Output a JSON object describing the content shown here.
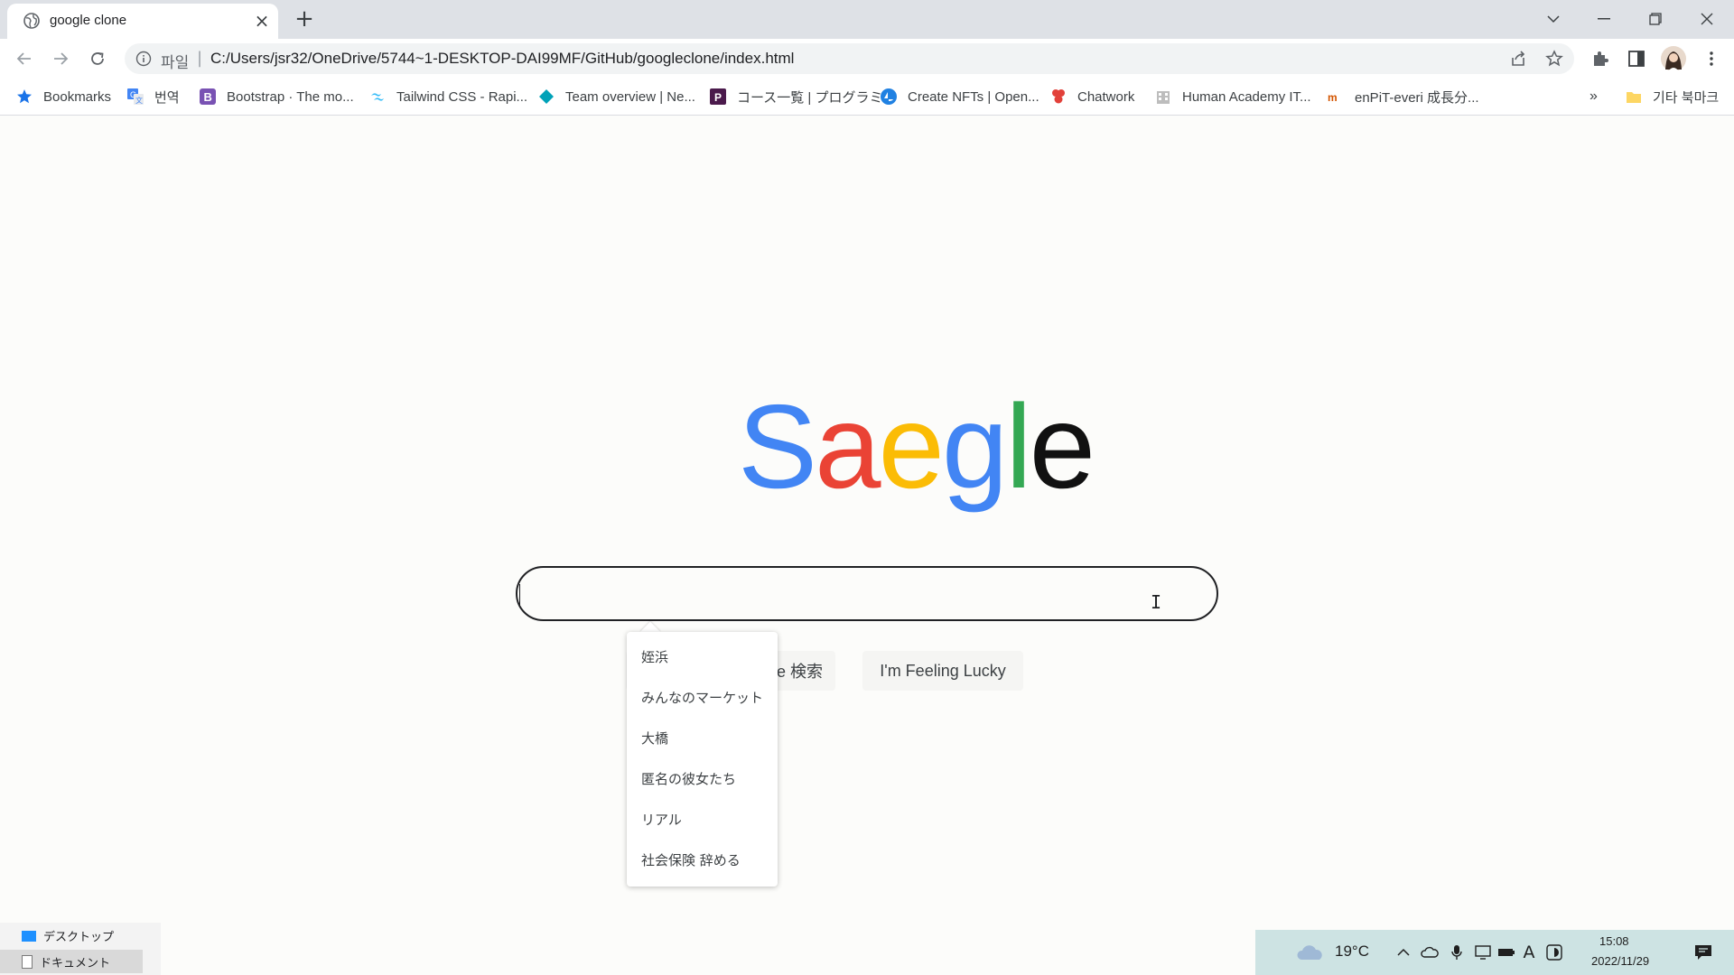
{
  "browser": {
    "tab_title": "google clone",
    "url_scheme_label": "파일",
    "url": "C:/Users/jsr32/OneDrive/5744~1-DESKTOP-DAI99MF/GitHub/googleclone/index.html"
  },
  "bookmarks": [
    {
      "label": "Bookmarks",
      "icon": "star-icon",
      "color": "#1a73e8"
    },
    {
      "label": "번역",
      "icon": "translate-icon",
      "color": "#4285f4"
    },
    {
      "label": "Bootstrap · The mo...",
      "icon": "bootstrap-icon",
      "color": "#7952b3"
    },
    {
      "label": "Tailwind CSS - Rapi...",
      "icon": "tailwind-icon",
      "color": "#38bdf8"
    },
    {
      "label": "Team overview | Ne...",
      "icon": "diamond-icon",
      "color": "#00a2b8"
    },
    {
      "label": "コース一覧 | プログラミ...",
      "icon": "progate-icon",
      "color": "#4b1a4c"
    },
    {
      "label": "Create NFTs | Open...",
      "icon": "opensea-icon",
      "color": "#2081e2"
    },
    {
      "label": "Chatwork",
      "icon": "chatwork-icon",
      "color": "#e2413a"
    },
    {
      "label": "Human Academy IT...",
      "icon": "building-icon",
      "color": "#777777"
    },
    {
      "label": "enPiT-everi 成長分...",
      "icon": "enpit-icon",
      "color": "#d35400"
    }
  ],
  "bookmarks_overflow": "»",
  "other_bookmarks": "기타 북마크",
  "logo": {
    "letters": [
      {
        "char": "S",
        "color": "#4285f4"
      },
      {
        "char": "a",
        "color": "#ea4335"
      },
      {
        "char": "e",
        "color": "#fbbc05"
      },
      {
        "char": "g",
        "color": "#4285f4"
      },
      {
        "char": "l",
        "color": "#34a853"
      },
      {
        "char": "e",
        "color": "#111111"
      }
    ]
  },
  "search": {
    "value": "",
    "search_button_partial": "e 検索",
    "lucky_button": "I'm Feeling Lucky"
  },
  "ime_suggestions": [
    "姪浜",
    "みんなのマーケット",
    "大橋",
    "匿名の彼女たち",
    "リアル",
    "社会保険 辞める"
  ],
  "taskbar_left": {
    "item1": "デスクトップ",
    "item2": "ドキュメント"
  },
  "tray": {
    "temperature": "19°C",
    "time": "15:08",
    "date": "2022/11/29",
    "ime_mode": "A"
  }
}
